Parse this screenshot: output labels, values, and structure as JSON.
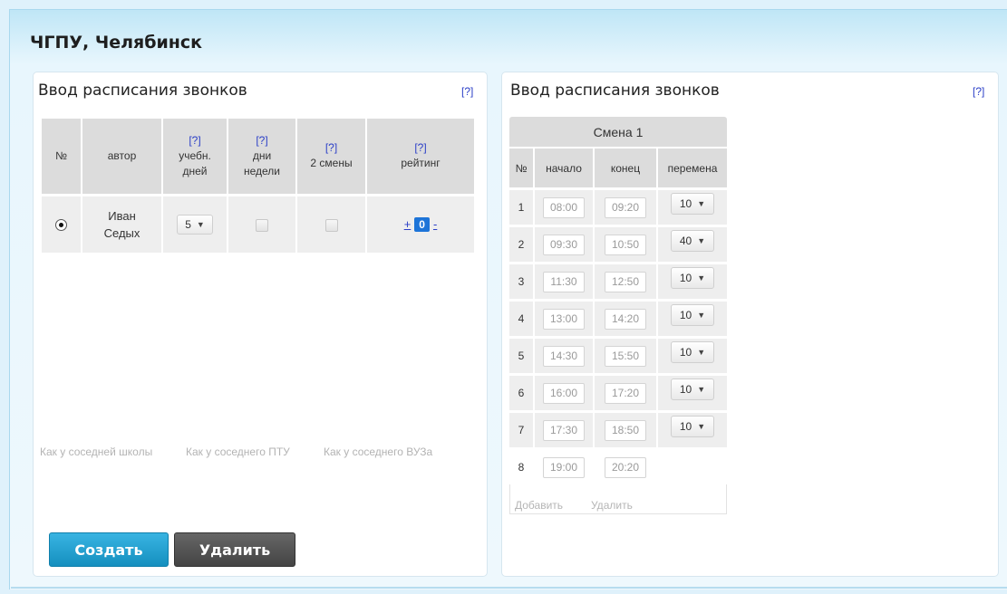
{
  "school_title": "ЧГПУ, Челябинск",
  "help_label": "[?]",
  "left_panel": {
    "title": "Ввод расписания звонков",
    "columns": {
      "num": "№",
      "author": "автор",
      "study_days_l1": "учебн.",
      "study_days_l2": "дней",
      "week_days_l1": "дни",
      "week_days_l2": "недели",
      "two_shifts": "2 смены",
      "rating": "рейтинг"
    },
    "row": {
      "selected": true,
      "author_l1": "Иван",
      "author_l2": "Седых",
      "study_days": "5",
      "week_days_checked": false,
      "two_shifts_checked": false,
      "rating_plus": "+",
      "rating_value": "0",
      "rating_minus": "-"
    },
    "presets": [
      "Как у соседней школы",
      "Как у соседнего ПТУ",
      "Как у соседнего ВУЗа"
    ],
    "create_button": "Создать",
    "delete_button": "Удалить"
  },
  "right_panel": {
    "title": "Ввод расписания звонков",
    "shift_label": "Смена 1",
    "columns": {
      "num": "№",
      "start": "начало",
      "end": "конец",
      "break": "перемена"
    },
    "lessons": [
      {
        "num": "1",
        "start": "08:00",
        "end": "09:20",
        "break": "10"
      },
      {
        "num": "2",
        "start": "09:30",
        "end": "10:50",
        "break": "40"
      },
      {
        "num": "3",
        "start": "11:30",
        "end": "12:50",
        "break": "10"
      },
      {
        "num": "4",
        "start": "13:00",
        "end": "14:20",
        "break": "10"
      },
      {
        "num": "5",
        "start": "14:30",
        "end": "15:50",
        "break": "10"
      },
      {
        "num": "6",
        "start": "16:00",
        "end": "17:20",
        "break": "10"
      },
      {
        "num": "7",
        "start": "17:30",
        "end": "18:50",
        "break": "10"
      },
      {
        "num": "8",
        "start": "19:00",
        "end": "20:20",
        "break": ""
      }
    ],
    "add_label": "Добавить",
    "remove_label": "Удалить"
  },
  "colors": {
    "link": "#2b3fc7",
    "create_button": "#1e9ccc",
    "delete_button": "#555555",
    "rating_badge": "#1d74d8"
  }
}
